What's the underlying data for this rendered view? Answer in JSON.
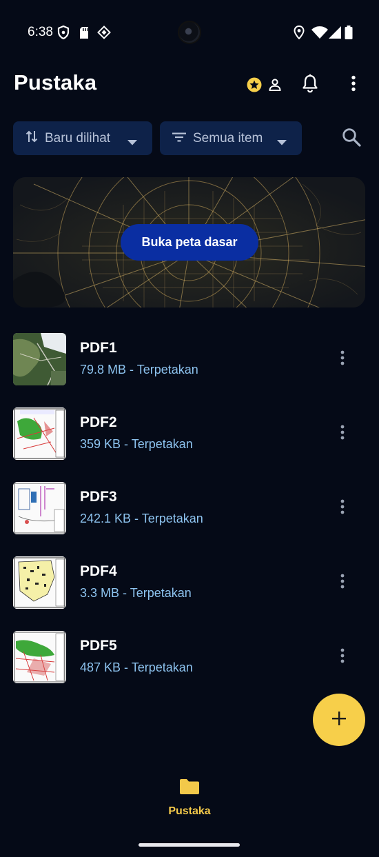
{
  "status_bar": {
    "time": "6:38",
    "icons": [
      "shield-icon",
      "sd-card-icon",
      "vpn-diamond-icon",
      "location-icon",
      "wifi-icon",
      "signal-icon",
      "battery-icon"
    ]
  },
  "header": {
    "title": "Pustaka",
    "actions": [
      "premium-account-icon",
      "notifications-bell-icon",
      "more-vertical-icon"
    ]
  },
  "filters": {
    "sort_label": "Baru dilihat",
    "filter_label": "Semua item"
  },
  "map_banner": {
    "button_label": "Buka peta dasar"
  },
  "files": [
    {
      "name": "PDF1",
      "meta": "79.8 MB - Terpetakan"
    },
    {
      "name": "PDF2",
      "meta": "359 KB - Terpetakan"
    },
    {
      "name": "PDF3",
      "meta": "242.1 KB - Terpetakan"
    },
    {
      "name": "PDF4",
      "meta": "3.3 MB - Terpetakan"
    },
    {
      "name": "PDF5",
      "meta": "487 KB - Terpetakan"
    }
  ],
  "bottom_nav": {
    "active_label": "Pustaka"
  },
  "colors": {
    "background": "#050a17",
    "accent": "#f7cf4a",
    "chip_background": "#0e2249",
    "primary_button": "#0a2ea2",
    "meta_text": "#8dc3ef"
  }
}
